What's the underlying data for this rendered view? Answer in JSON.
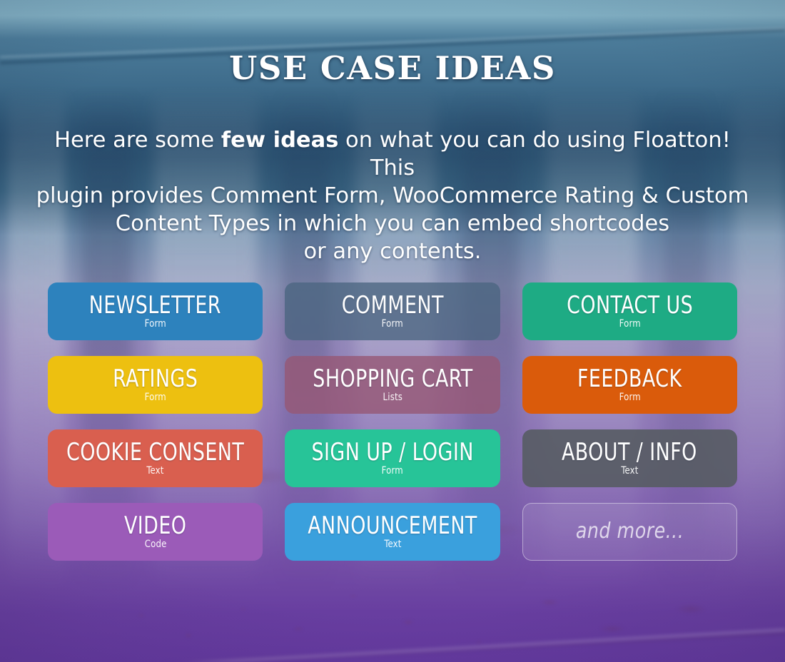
{
  "header": {
    "title": "USE CASE IDEAS"
  },
  "intro": {
    "line_prefix": "Here are some ",
    "emphasis": "few ideas",
    "line_suffix": " on what you can do using Floatton! This\nplugin provides Comment Form, WooCommerce Rating & Custom\nContent Types in which you can embed shortcodes\nor any contents."
  },
  "colors": {
    "newsletter": "#2d82bd",
    "comment": "rgba(74,101,128,0.78)",
    "contact_us": "#1eab84",
    "ratings": "#edc010",
    "shopping_cart": "rgba(150,88,116,0.80)",
    "feedback": "#da5b0b",
    "cookie_consent": "#d95f4f",
    "sign_up_login": "#27c498",
    "about_info": "rgba(86,92,99,0.90)",
    "video": "#9b5bb8",
    "announcement": "#3aa0dd",
    "and_more": "rgba(255,255,255,0.10)"
  },
  "tiles": [
    {
      "title": "NEWSLETTER",
      "subtitle": "Form",
      "color_key": "newsletter",
      "style": "solid"
    },
    {
      "title": "COMMENT",
      "subtitle": "Form",
      "color_key": "comment",
      "style": "solid"
    },
    {
      "title": "CONTACT US",
      "subtitle": "Form",
      "color_key": "contact_us",
      "style": "solid"
    },
    {
      "title": "RATINGS",
      "subtitle": "Form",
      "color_key": "ratings",
      "style": "solid"
    },
    {
      "title": "SHOPPING CART",
      "subtitle": "Lists",
      "color_key": "shopping_cart",
      "style": "solid"
    },
    {
      "title": "FEEDBACK",
      "subtitle": "Form",
      "color_key": "feedback",
      "style": "solid"
    },
    {
      "title": "COOKIE CONSENT",
      "subtitle": "Text",
      "color_key": "cookie_consent",
      "style": "solid"
    },
    {
      "title": "SIGN UP / LOGIN",
      "subtitle": "Form",
      "color_key": "sign_up_login",
      "style": "solid"
    },
    {
      "title": "ABOUT / INFO",
      "subtitle": "Text",
      "color_key": "about_info",
      "style": "solid"
    },
    {
      "title": "VIDEO",
      "subtitle": "Code",
      "color_key": "video",
      "style": "solid"
    },
    {
      "title": "ANNOUNCEMENT",
      "subtitle": "Text",
      "color_key": "announcement",
      "style": "solid"
    },
    {
      "title": "and more...",
      "subtitle": "",
      "color_key": "and_more",
      "style": "ghost"
    }
  ]
}
